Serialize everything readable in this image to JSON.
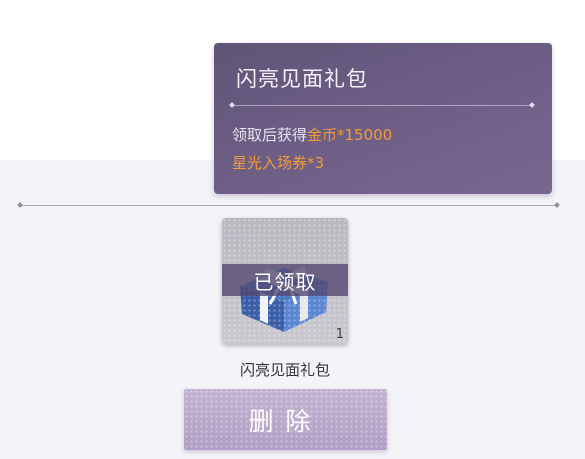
{
  "tooltip": {
    "title": "闪亮见面礼包",
    "desc_prefix": "领取后获得",
    "reward1_text": "金币*15000",
    "reward2_text": "星光入场券*3"
  },
  "item": {
    "status": "已领取",
    "count": "1",
    "name": "闪亮见面礼包",
    "icon": "gift-box-icon"
  },
  "actions": {
    "delete_label": "删除"
  },
  "colors": {
    "tooltip_bg": "#6a5a84",
    "highlight": "#f39a3a",
    "button_bg": "#b9a8cb"
  }
}
